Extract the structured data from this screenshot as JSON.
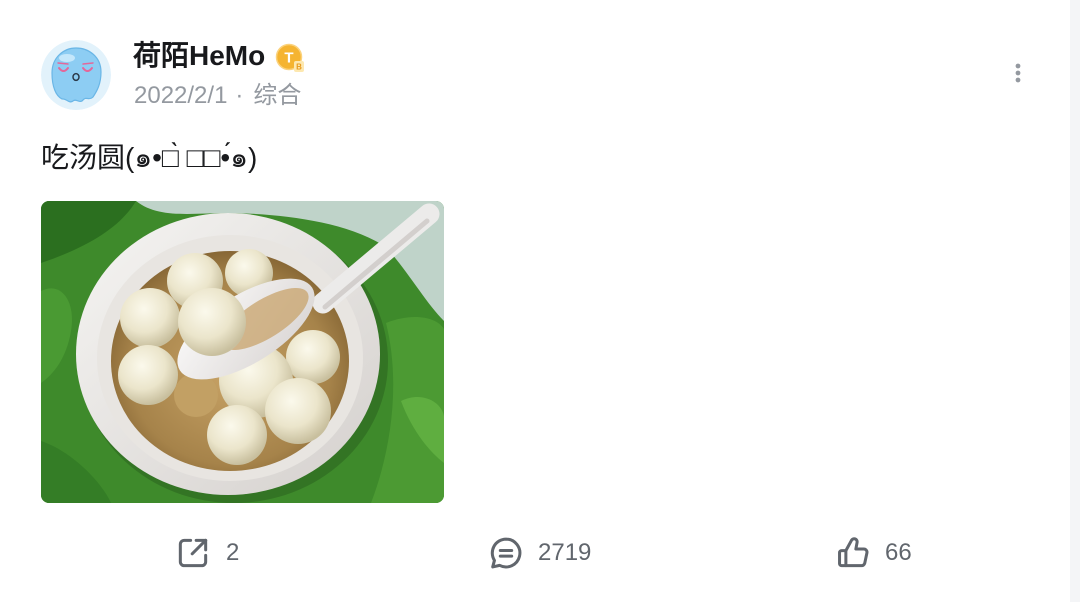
{
  "post": {
    "author": {
      "name": "荷陌HeMo",
      "avatar_icon": "avatar-icon",
      "badge": {
        "icon": "level-badge-icon",
        "letter": "T",
        "sub_letter": "B",
        "color": "#f5b431"
      }
    },
    "meta": {
      "date": "2022/2/1",
      "separator": "·",
      "category": "综合"
    },
    "text": "吃汤圆(๑•□̀ □□•́๑)",
    "more_icon": "more-vertical-icon"
  },
  "actions": {
    "share": {
      "icon": "share-icon",
      "count": "2"
    },
    "comment": {
      "icon": "comment-icon",
      "count": "2719"
    },
    "like": {
      "icon": "like-icon",
      "count": "66"
    }
  },
  "colors": {
    "text_primary": "#18191c",
    "text_secondary": "#9499a0",
    "action": "#61666d",
    "background": "#ffffff"
  }
}
